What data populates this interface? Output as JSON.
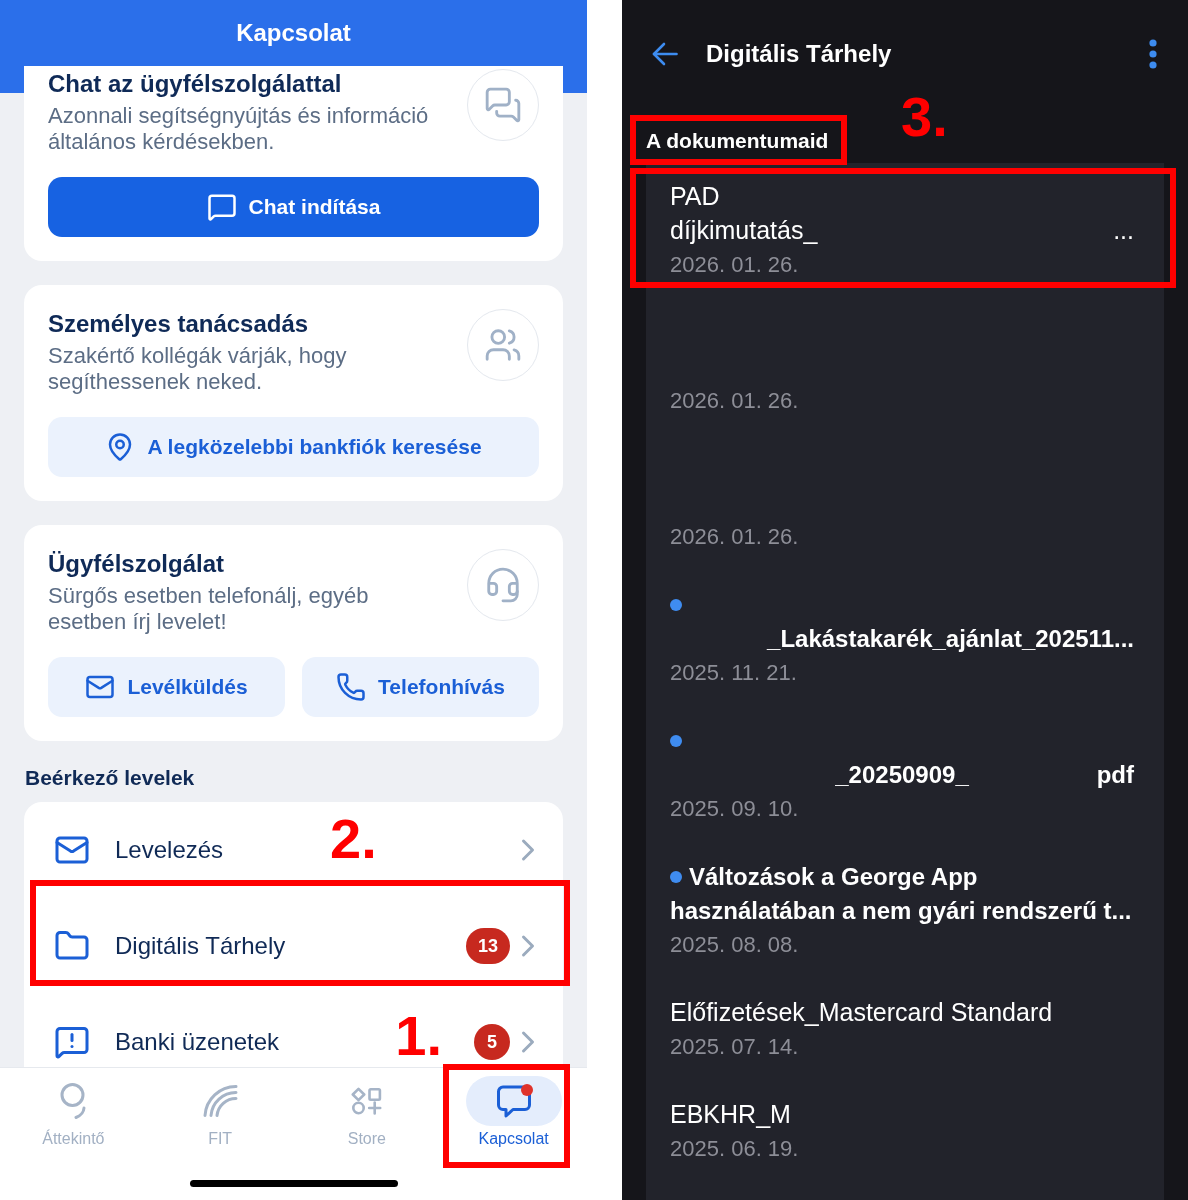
{
  "left_screen": {
    "header": {
      "title": "Kapcsolat"
    },
    "cards": [
      {
        "title": "Chat az ügyfélszolgálattal",
        "description": [
          "Azonnali segítségnyújtás és információ",
          "általános kérdésekben."
        ],
        "buttons": [
          {
            "label": "Chat indítása",
            "kind": "primary"
          }
        ]
      },
      {
        "title": "Személyes tanácsadás",
        "description": [
          "Szakértő kollégák várják, hogy",
          "segíthessenek neked."
        ],
        "buttons": [
          {
            "label": "A legközelebbi bankfiók keresése",
            "kind": "secondary"
          }
        ]
      },
      {
        "title": "Ügyfélszolgálat",
        "description": [
          "Sürgős esetben telefonálj, egyéb",
          "esetben írj levelet!"
        ],
        "buttons": [
          {
            "label": "Levélküldés",
            "kind": "secondary"
          },
          {
            "label": "Telefonhívás",
            "kind": "secondary"
          }
        ]
      }
    ],
    "inbox": {
      "title": "Beérkező levelek",
      "items": [
        {
          "label": "Levelezés",
          "highlighted": false
        },
        {
          "label": "Digitális Tárhely",
          "badge": "13",
          "highlighted": true,
          "callout": "2."
        },
        {
          "label": "Banki üzenetek",
          "badge": "5",
          "highlighted": false
        }
      ]
    },
    "nav": [
      {
        "label": "Áttekintő",
        "selected": false,
        "notification": false,
        "highlighted": false
      },
      {
        "label": "FIT",
        "selected": false,
        "notification": false,
        "highlighted": false
      },
      {
        "label": "Store",
        "selected": false,
        "notification": false,
        "highlighted": false
      },
      {
        "label": "Kapcsolat",
        "selected": true,
        "notification": true,
        "highlighted": true,
        "callout": "1."
      }
    ]
  },
  "right_screen": {
    "header": {
      "title": "Digitális Tárhely"
    },
    "section": {
      "title": "A dokumentumaid",
      "highlighted": true,
      "callout": "3."
    },
    "documents": [
      {
        "unread": false,
        "highlighted": true,
        "title_lines": [
          {
            "kind": "text",
            "left": "PAD"
          },
          {
            "kind": "text",
            "left": "díjkimutatás_",
            "right": "..."
          }
        ],
        "date": "2026. 01. 26."
      },
      {
        "unread": false,
        "highlighted": false,
        "title_lines": [
          {
            "kind": "blank"
          },
          {
            "kind": "blank"
          }
        ],
        "date": "2026. 01. 26."
      },
      {
        "unread": false,
        "highlighted": false,
        "title_lines": [
          {
            "kind": "blank"
          },
          {
            "kind": "blank"
          }
        ],
        "date": "2026. 01. 26."
      },
      {
        "unread": true,
        "highlighted": false,
        "title_lines": [
          {
            "kind": "blank"
          },
          {
            "kind": "text",
            "right": "_Lakástakarék_ajánlat_202511..."
          }
        ],
        "date": "2025. 11. 21."
      },
      {
        "unread": true,
        "highlighted": false,
        "title_lines": [
          {
            "kind": "blank"
          },
          {
            "kind": "text",
            "center": "_20250909_",
            "right": "pdf"
          }
        ],
        "date": "2025. 09. 10."
      },
      {
        "unread": true,
        "highlighted": false,
        "title_lines": [
          {
            "kind": "text",
            "left": "Változások a George App"
          },
          {
            "kind": "text",
            "left": "használatában a nem gyári rendszerű t..."
          }
        ],
        "date": "2025. 08. 08."
      },
      {
        "unread": false,
        "highlighted": false,
        "title_lines": [
          {
            "kind": "text",
            "left": "Előfizetések_Mastercard Standard"
          }
        ],
        "date": "2025. 07. 14."
      },
      {
        "unread": false,
        "highlighted": false,
        "title_lines": [
          {
            "kind": "text",
            "left": "EBKHR_M"
          }
        ],
        "date": "2025. 06. 19."
      }
    ]
  }
}
